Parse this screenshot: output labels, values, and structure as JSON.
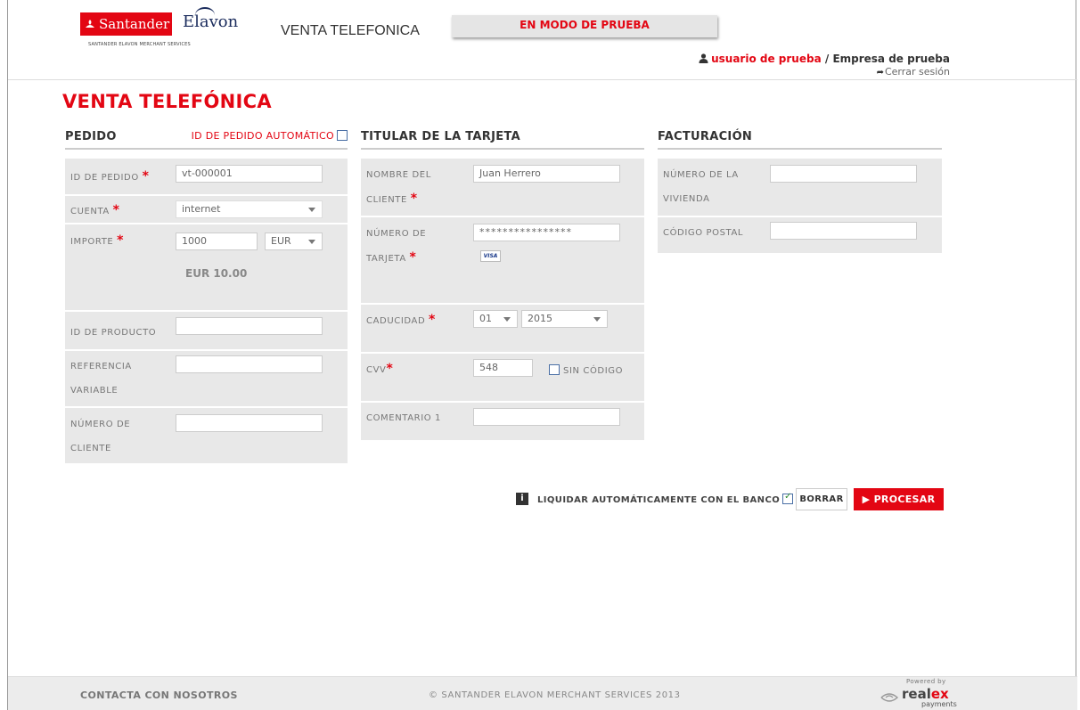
{
  "header": {
    "brand_santander": "Santander",
    "brand_elavon": "Elavon",
    "brand_sub": "SANTANDER ELAVON MERCHANT SERVICES",
    "app_title": "VENTA TELEFONICA",
    "test_mode": "EN MODO DE PRUEBA",
    "user": "usuario de prueba",
    "separator": "/",
    "company": "Empresa de prueba",
    "logout": "Cerrar sesión"
  },
  "page_title": "VENTA TELEFÓNICA",
  "pedido": {
    "heading": "PEDIDO",
    "auto_id_label": "ID DE PEDIDO AUTOMÁTICO",
    "auto_id_checked": false,
    "order_id_label": "ID DE PEDIDO",
    "order_id_value": "vt-000001",
    "account_label": "CUENTA",
    "account_value": "internet",
    "amount_label": "IMPORTE",
    "amount_value": "1000",
    "currency_value": "EUR",
    "amount_display": "EUR 10.00",
    "product_id_label": "ID DE PRODUCTO",
    "product_id_value": "",
    "variable_ref_label_1": "REFERENCIA",
    "variable_ref_label_2": "VARIABLE",
    "variable_ref_value": "",
    "customer_number_label_1": "NÚMERO DE",
    "customer_number_label_2": "CLIENTE",
    "customer_number_value": ""
  },
  "titular": {
    "heading": "TITULAR DE LA TARJETA",
    "name_label_1": "NOMBRE DEL",
    "name_label_2": "CLIENTE",
    "name_value": "Juan Herrero",
    "card_label_1": "NÚMERO DE",
    "card_label_2": "TARJETA",
    "card_value": "****************",
    "card_brand": "VISA",
    "expiry_label": "CADUCIDAD",
    "expiry_month": "01",
    "expiry_year": "2015",
    "cvv_label": "CVV",
    "cvv_value": "548",
    "no_code_label": "SIN CÓDIGO",
    "no_code_checked": false,
    "comment_label": "COMENTARIO 1",
    "comment_value": ""
  },
  "facturacion": {
    "heading": "FACTURACIÓN",
    "house_label_1": "NÚMERO DE LA",
    "house_label_2": "VIVIENDA",
    "house_value": "",
    "postcode_label": "CÓDIGO POSTAL",
    "postcode_value": ""
  },
  "actions": {
    "info_icon_text": "i",
    "settle_label": "LIQUIDAR AUTOMÁTICAMENTE CON EL BANCO",
    "settle_checked": true,
    "clear_label": "BORRAR",
    "process_label": "PROCESAR"
  },
  "footer": {
    "contact": "CONTACTA CON NOSOTROS",
    "copyright": "© SANTANDER ELAVON MERCHANT SERVICES 2013",
    "powered_by": "Powered by",
    "realex_a": "real",
    "realex_b": "ex",
    "realex_sub": "payments"
  },
  "colors": {
    "brand_red": "#e30613",
    "panel_gray": "#e8e8e8",
    "elavon_navy": "#1a2b5c"
  }
}
